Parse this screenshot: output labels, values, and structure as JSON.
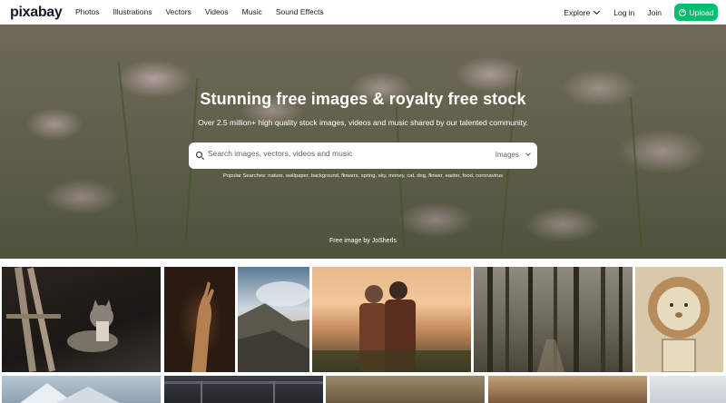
{
  "header": {
    "logo": "pixabay",
    "nav": [
      "Photos",
      "Illustrations",
      "Vectors",
      "Videos",
      "Music",
      "Sound Effects"
    ],
    "explore": "Explore",
    "login": "Log in",
    "join": "Join",
    "upload": "Upload"
  },
  "hero": {
    "title": "Stunning free images & royalty free stock",
    "subtitle": "Over 2.5 million+ high quality stock images, videos and music shared by our talented community.",
    "search_placeholder": "Search images, vectors, videos and music",
    "search_type": "Images",
    "popular_searches": "Popular Searches: nature, wallpaper, background, flowers, spring, sky, money, cat, dog, flower, easter, food, coronavirus",
    "credit": "Free image by JoSherls"
  },
  "colors": {
    "accent": "#02be6e",
    "text": "#191b26"
  }
}
